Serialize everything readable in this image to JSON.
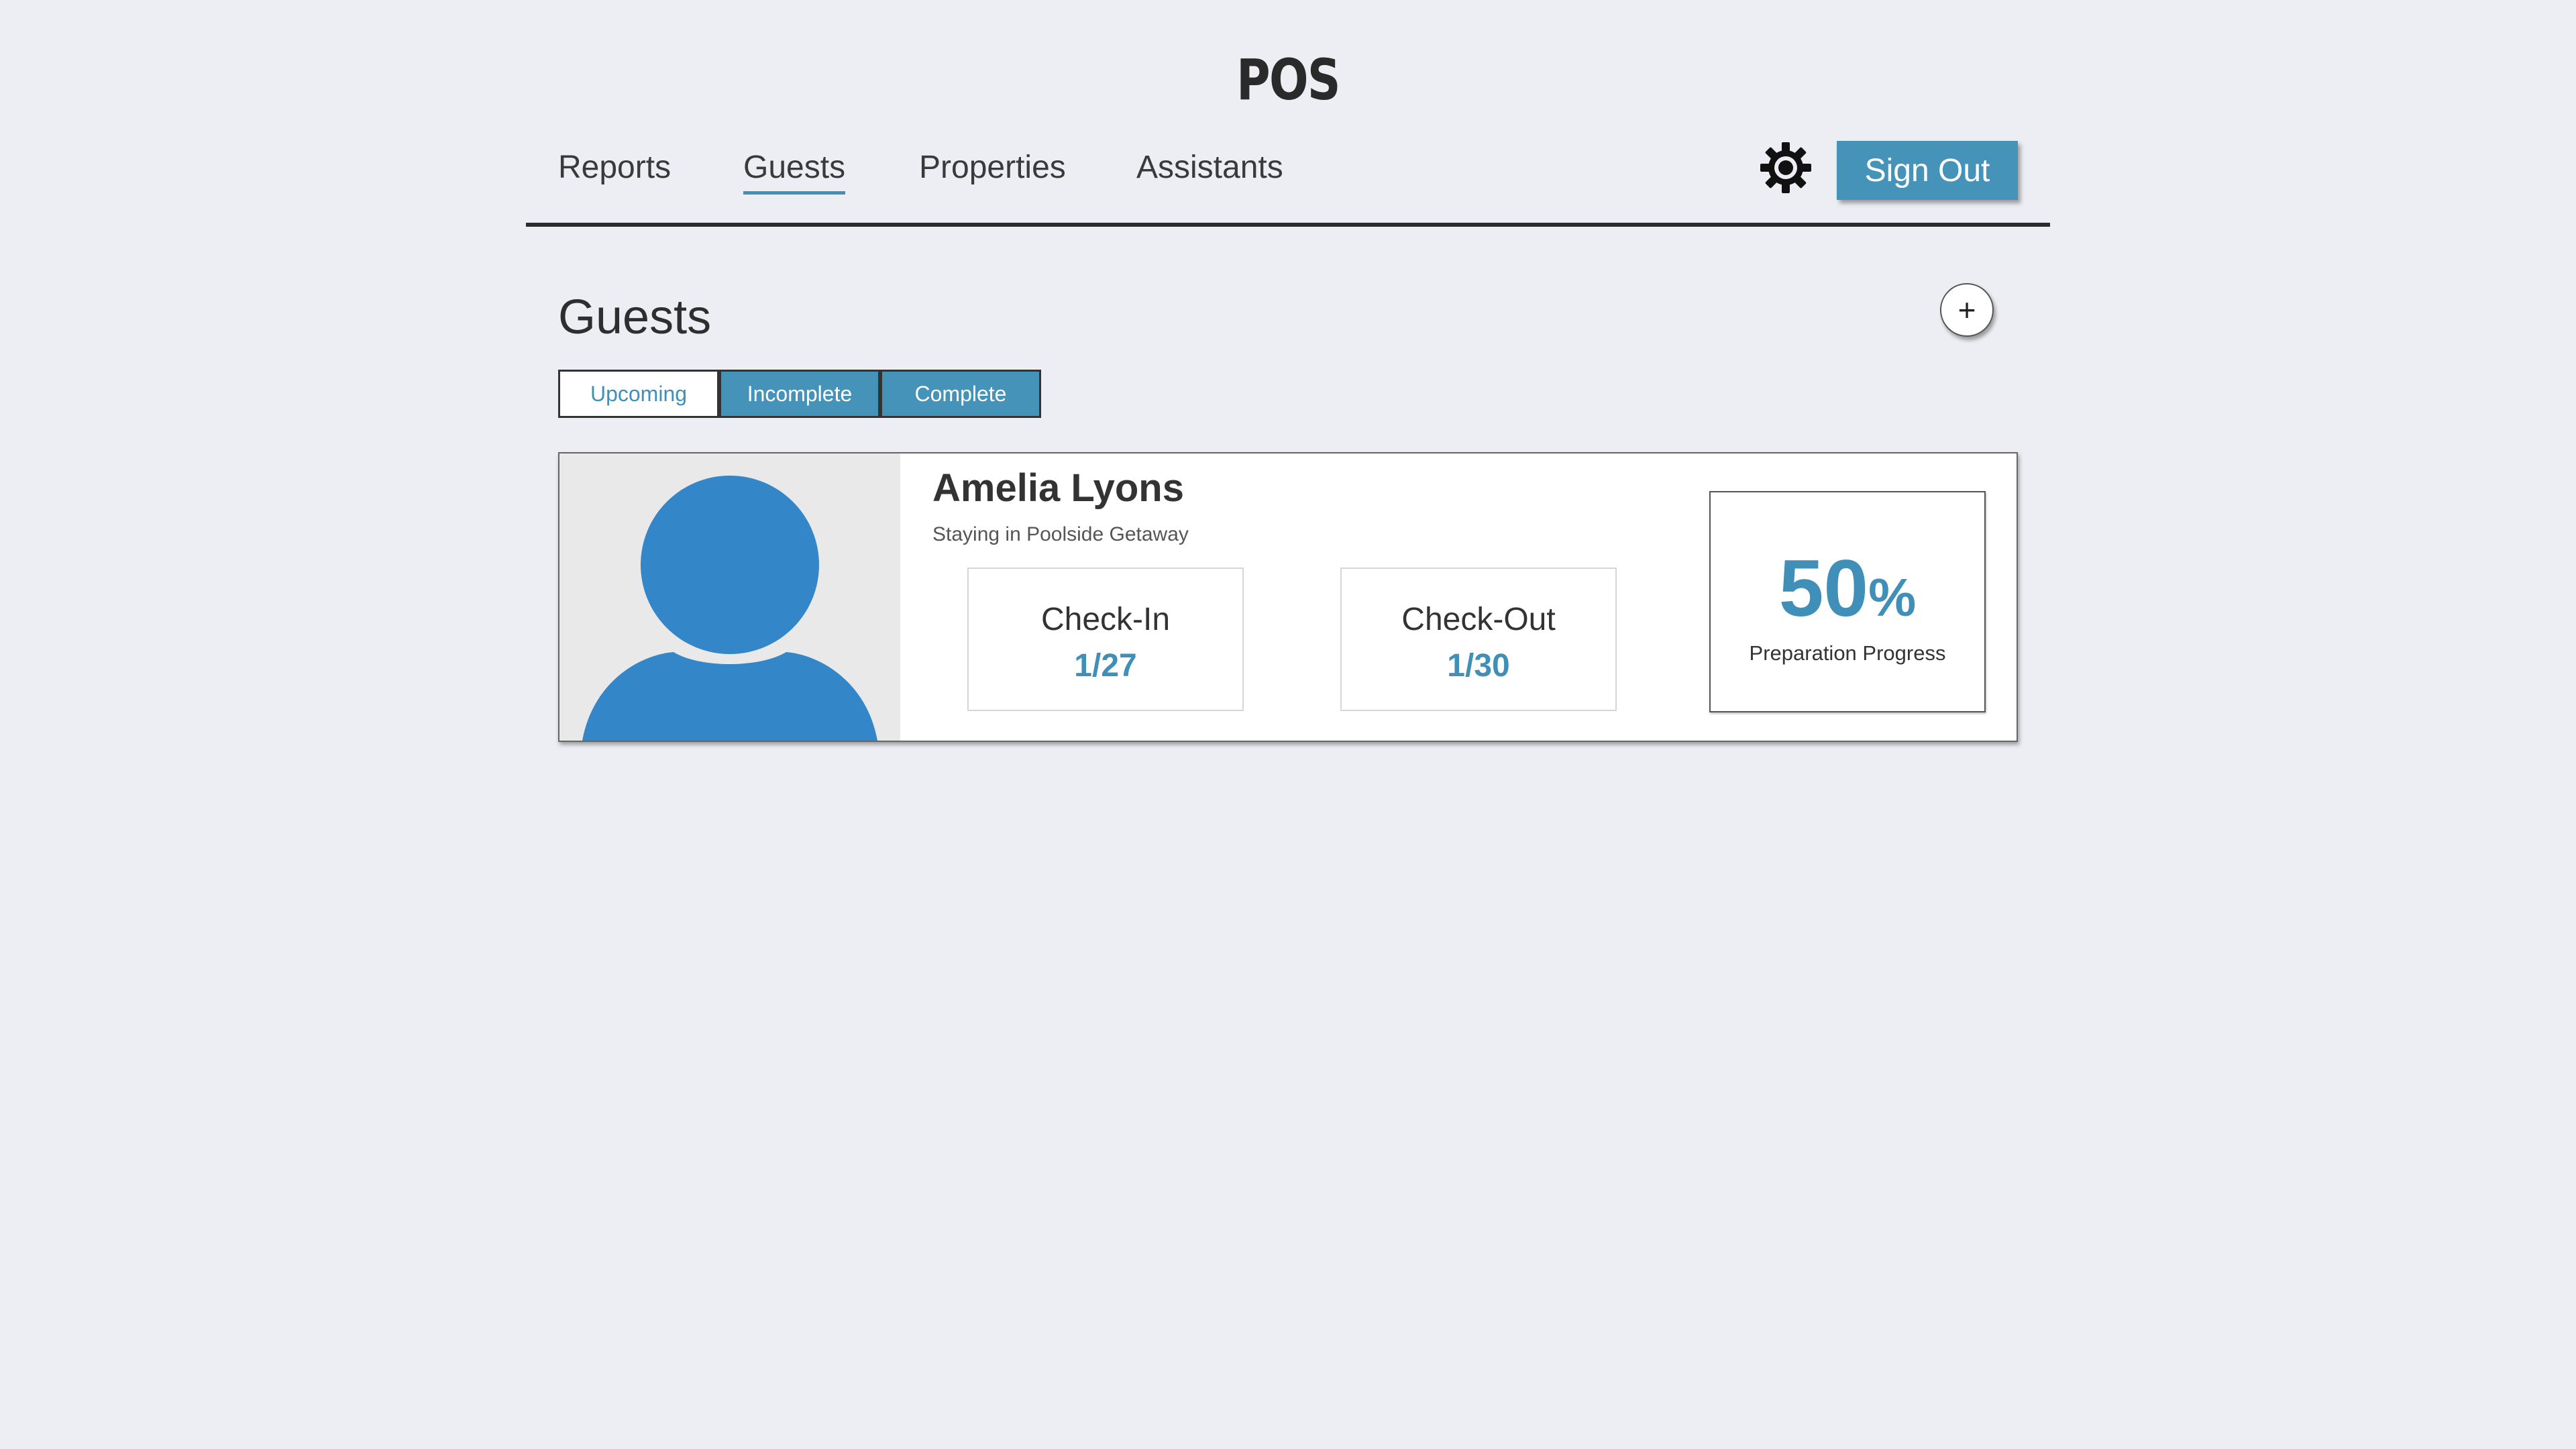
{
  "app": {
    "title": "POS"
  },
  "nav": {
    "items": [
      {
        "label": "Reports"
      },
      {
        "label": "Guests",
        "active": true
      },
      {
        "label": "Properties"
      },
      {
        "label": "Assistants"
      }
    ],
    "settings_icon": "gear-icon",
    "sign_out_label": "Sign Out"
  },
  "page": {
    "title": "Guests",
    "add_label": "+",
    "tabs": [
      {
        "label": "Upcoming",
        "selected": true
      },
      {
        "label": "Incomplete"
      },
      {
        "label": "Complete"
      }
    ]
  },
  "guest": {
    "name": "Amelia Lyons",
    "stay": "Staying in Poolside Getaway",
    "check_in_label": "Check-In",
    "check_in": "1/27",
    "check_out_label": "Check-Out",
    "check_out": "1/30",
    "progress_value": "50",
    "progress_unit": "%",
    "progress_label": "Preparation Progress"
  },
  "colors": {
    "background": "#edeef3",
    "accent": "#4593b9",
    "avatar": "#3387c8",
    "text": "#2e2e2e"
  }
}
